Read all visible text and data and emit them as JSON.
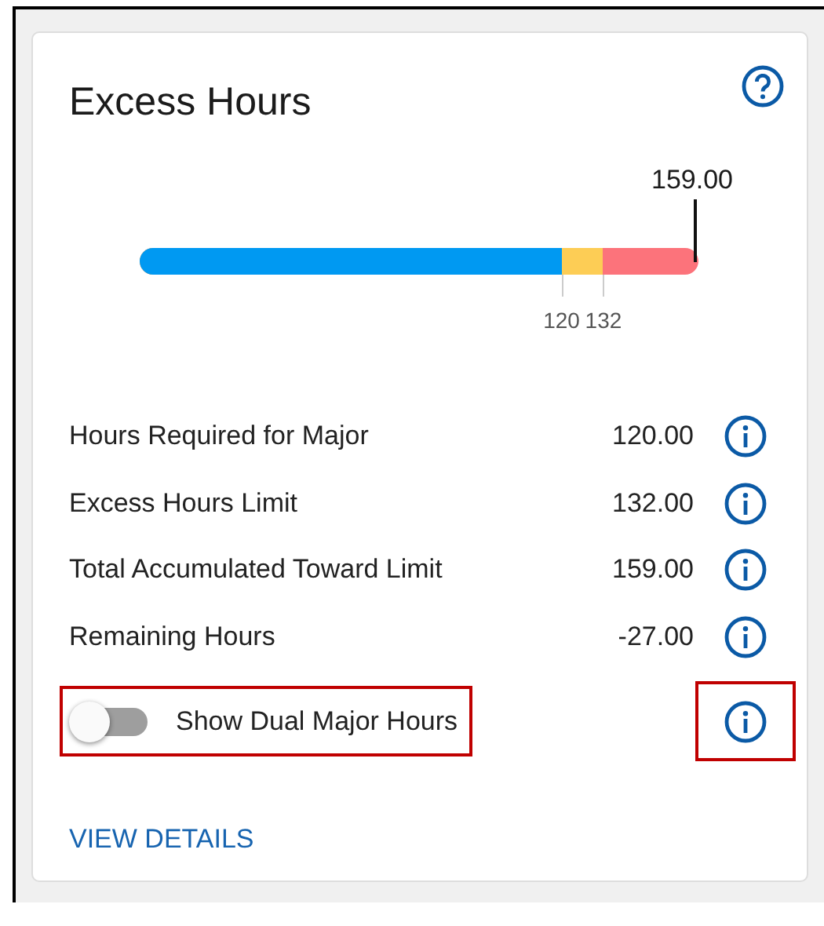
{
  "card": {
    "title": "Excess Hours"
  },
  "progress": {
    "segments": [
      {
        "level": 0.755,
        "color": "#0099f2"
      },
      {
        "level": 0.83,
        "color": "#fdcd55"
      }
    ],
    "marker_label": "159.00",
    "tick_labels": [
      "120",
      "132"
    ]
  },
  "rows": [
    {
      "label": "Hours Required for Major",
      "value": "120.00"
    },
    {
      "label": "Excess Hours Limit",
      "value": "132.00"
    },
    {
      "label": "Total Accumulated Toward Limit",
      "value": "159.00"
    },
    {
      "label": "Remaining Hours",
      "value": "-27.00"
    }
  ],
  "dual_toggle": {
    "label": "Show Dual Major Hours",
    "on": false,
    "highlighted": true,
    "info_highlighted": true
  },
  "link": "VIEW DETAILS"
}
